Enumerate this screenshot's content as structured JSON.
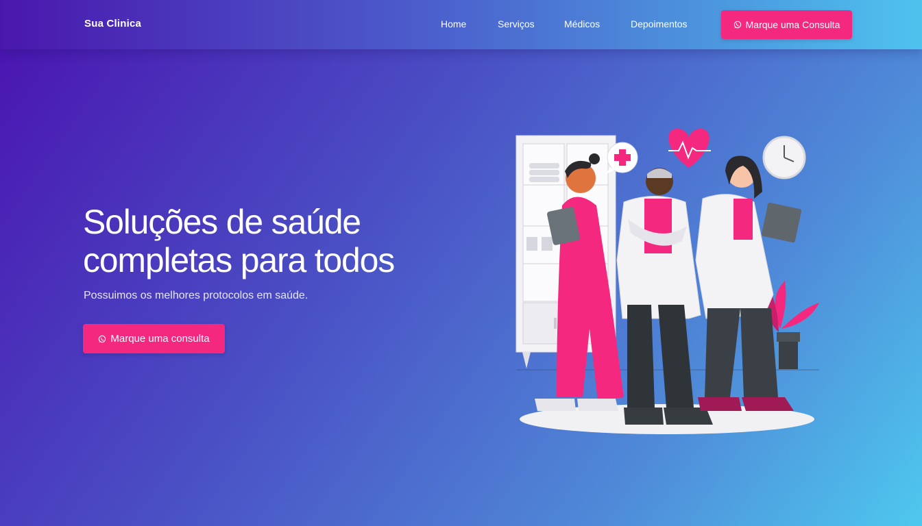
{
  "header": {
    "brand": "Sua Clinica",
    "nav": [
      "Home",
      "Serviços",
      "Médicos",
      "Depoimentos"
    ],
    "cta_label": "Marque uma Consulta"
  },
  "hero": {
    "title_line1": "Soluções de saúde",
    "title_line2": "completas para todos",
    "subtitle": "Possuimos os melhores protocolos em saúde.",
    "cta_label": "Marque uma consulta"
  },
  "icons": {
    "cta_icon": "whatsapp-icon",
    "illustration": "doctors-illustration"
  },
  "colors": {
    "accent": "#f4287f",
    "gradient_start": "#4a12b0",
    "gradient_end": "#4ec8ee"
  }
}
